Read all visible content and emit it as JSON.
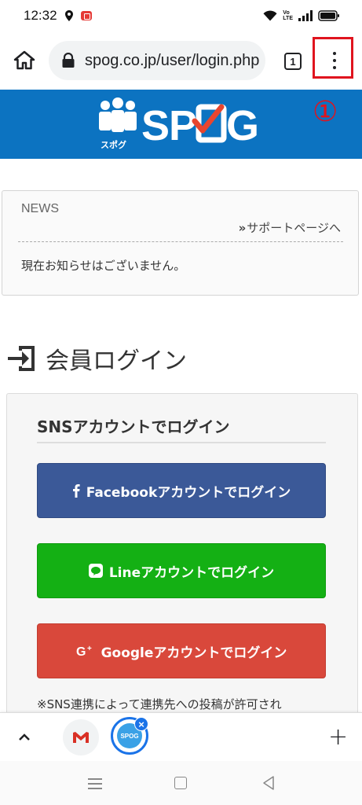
{
  "status_bar": {
    "time": "12:32",
    "volte": "Vo LTE"
  },
  "browser": {
    "url": "spog.co.jp/user/login.php",
    "tab_count": "1"
  },
  "annotation": {
    "marker": "①",
    "color": "#e0141e"
  },
  "site": {
    "logo_text": "SPOG",
    "logo_sub": "スポグ",
    "header_color": "#0c73c1"
  },
  "news": {
    "title": "NEWS",
    "support_link": "サポートページへ",
    "body": "現在お知らせはございません。"
  },
  "login": {
    "heading": "会員ログイン",
    "sns_title": "SNSアカウントでログイン",
    "buttons": {
      "facebook": "Facebookアカウントでログイン",
      "line": "Lineアカウントでログイン",
      "google": "Googleアカウントでログイン"
    },
    "note": "※SNS連携によって連携先への投稿が許可され"
  },
  "tab_strip": {
    "spog_favicon": "SPOG"
  },
  "icons": [
    "home-icon",
    "lock-icon",
    "more-vert-icon",
    "chevron-up-icon",
    "gmail-icon",
    "plus-icon",
    "login-icon",
    "facebook-icon",
    "line-icon",
    "google-plus-icon"
  ]
}
